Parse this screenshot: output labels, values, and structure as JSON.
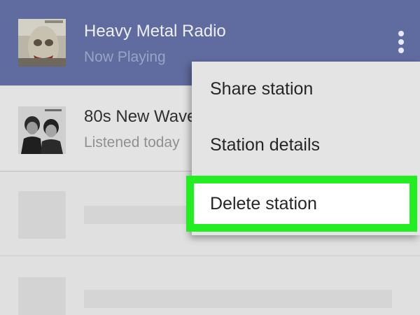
{
  "stations": [
    {
      "title": "Heavy Metal Radio",
      "subtitle": "Now Playing",
      "art_icon": "album-art-metal",
      "active": true
    },
    {
      "title": "80s New Wave",
      "subtitle": "Listened today",
      "art_icon": "album-art-newwave",
      "active": false
    }
  ],
  "overflow_icon": "more-vert-icon",
  "context_menu": {
    "items": [
      {
        "label": "Share station"
      },
      {
        "label": "Station details"
      },
      {
        "label": "Delete station",
        "highlighted": true
      }
    ]
  },
  "colors": {
    "active_row": "#606b9f",
    "highlight_border": "#22ee22",
    "menu_background": "#e4e4e4"
  }
}
